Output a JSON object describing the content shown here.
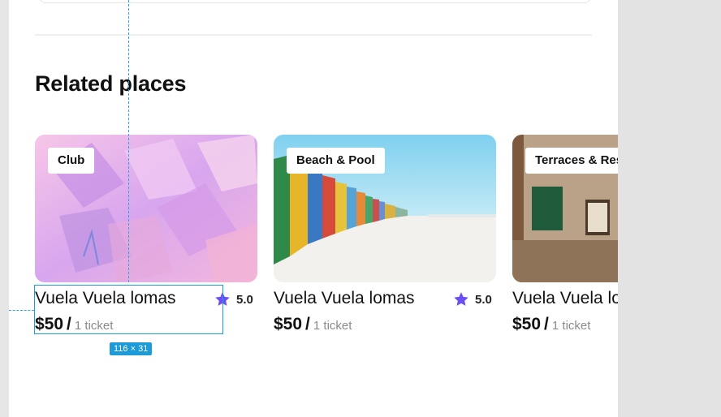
{
  "section": {
    "title": "Related places"
  },
  "cards": [
    {
      "tag": "Club",
      "name": "Vuela Vuela lomas",
      "rating": "5.0",
      "price": "$50",
      "slash": "/",
      "unit": "1 ticket"
    },
    {
      "tag": "Beach & Pool",
      "name": "Vuela Vuela lomas",
      "rating": "5.0",
      "price": "$50",
      "slash": "/",
      "unit": "1 ticket"
    },
    {
      "tag": "Terraces & Res",
      "name": "Vuela Vuela lo",
      "price": "$50",
      "slash": "/",
      "unit": "1 ticket"
    }
  ],
  "inspector": {
    "size_label": "116 × 31"
  },
  "colors": {
    "star": "#6c4ef2",
    "selection": "#1d9bd8"
  },
  "icons": {
    "rating": "star-icon"
  }
}
